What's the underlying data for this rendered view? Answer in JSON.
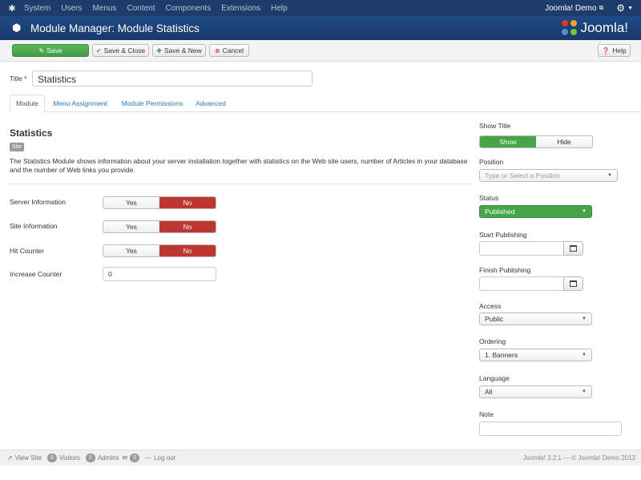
{
  "navbar": {
    "menu": [
      "System",
      "Users",
      "Menus",
      "Content",
      "Components",
      "Extensions",
      "Help"
    ],
    "user_label": "Joomla! Demo"
  },
  "header": {
    "title": "Module Manager: Module Statistics",
    "brand": "Joomla!"
  },
  "toolbar": {
    "save": "Save",
    "save_close": "Save & Close",
    "save_new": "Save & New",
    "cancel": "Cancel",
    "help": "Help"
  },
  "title_field": {
    "label": "Title *",
    "value": "Statistics"
  },
  "tabs": [
    "Module",
    "Menu Assignment",
    "Module Permissions",
    "Advanced"
  ],
  "module": {
    "name": "Statistics",
    "badge": "Site",
    "description": "The Statistics Module shows information about your server installation together with statistics on the Web site users, number of Articles in your database and the number of Web links you provide.",
    "options": [
      {
        "label": "Server Information",
        "yes": "Yes",
        "no": "No",
        "selected": "No"
      },
      {
        "label": "Site Information",
        "yes": "Yes",
        "no": "No",
        "selected": "No"
      },
      {
        "label": "Hit Counter",
        "yes": "Yes",
        "no": "No",
        "selected": "No"
      }
    ],
    "increase_counter": {
      "label": "Increase Counter",
      "value": "0"
    }
  },
  "sidebar": {
    "show_title": {
      "label": "Show Title",
      "show": "Show",
      "hide": "Hide",
      "selected": "Show"
    },
    "position": {
      "label": "Position",
      "placeholder": "Type or Select a Position"
    },
    "status": {
      "label": "Status",
      "value": "Published"
    },
    "start_publishing": {
      "label": "Start Publishing"
    },
    "finish_publishing": {
      "label": "Finish Publishing"
    },
    "access": {
      "label": "Access",
      "value": "Public"
    },
    "ordering": {
      "label": "Ordering",
      "value": "1. Banners"
    },
    "language": {
      "label": "Language",
      "value": "All"
    },
    "note": {
      "label": "Note"
    }
  },
  "statusbar": {
    "view_site": "View Site",
    "visitors_count": "0",
    "visitors": "Visitors",
    "admins_count": "0",
    "admins": "Admins",
    "messages_count": "0",
    "logout": "Log out",
    "footer": "Joomla! 3.2.1 — © Joomla! Demo 2013"
  },
  "colors": {
    "navbar": "#1d3b6b",
    "header": "#1f4a86",
    "success": "#46a546",
    "danger": "#bd362f",
    "link": "#2a7ac0"
  }
}
